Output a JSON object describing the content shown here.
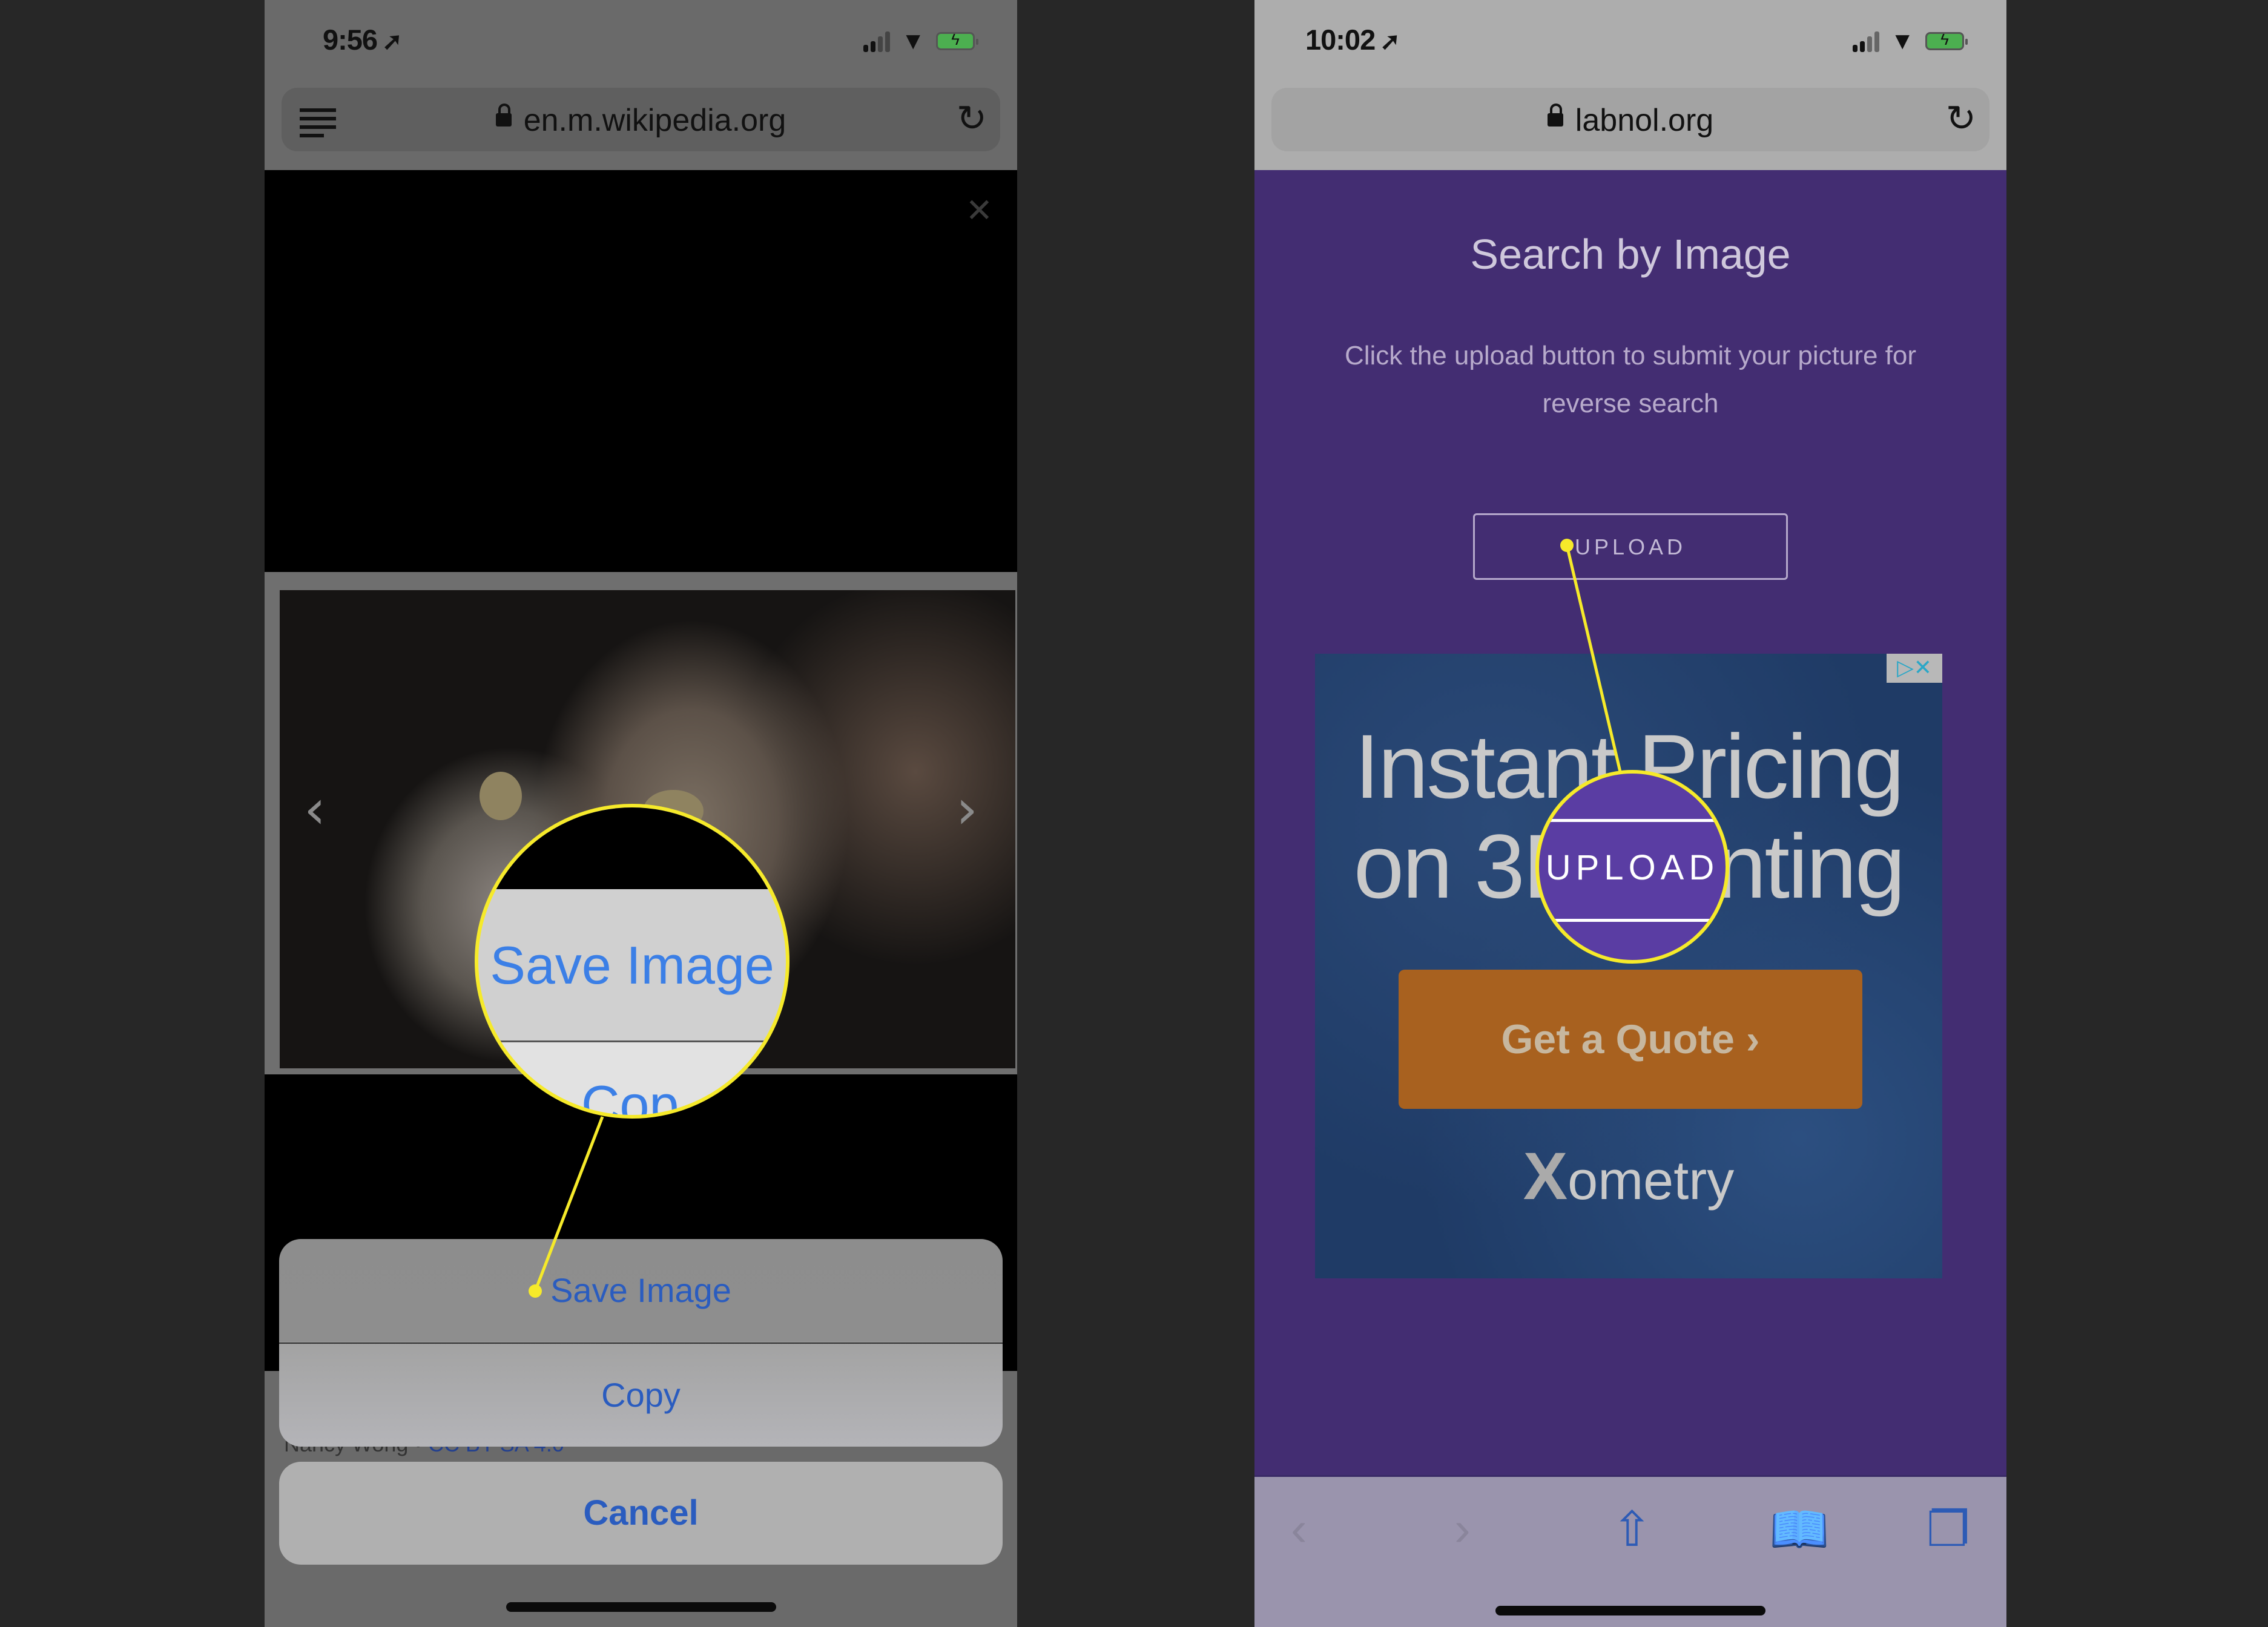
{
  "left_phone": {
    "status": {
      "time": "9:56",
      "location_glyph": "➚"
    },
    "url": "en.m.wikipedia.org",
    "reader_icon": "reader-icon",
    "close_glyph": "✕",
    "prev_glyph": "‹",
    "next_glyph": "›",
    "caption": {
      "author": "Nancy Wong",
      "separator": " • ",
      "license": "CC BY-SA 4.0"
    },
    "action_sheet": {
      "items": [
        "Save Image",
        "Copy"
      ],
      "cancel": "Cancel"
    },
    "magnifier": {
      "label": "Save Image",
      "peek": "Cop"
    }
  },
  "right_phone": {
    "status": {
      "time": "10:02",
      "location_glyph": "➚"
    },
    "url": "labnol.org",
    "title": "Search by Image",
    "description": "Click the upload button to submit your picture for reverse search",
    "upload_label": "UPLOAD",
    "ad": {
      "headline_line1": "Instant Pricing",
      "headline_line2": "on 3D Printing",
      "cta": "Get a Quote ›",
      "brand_x": "X",
      "brand_rest": "ometry",
      "adchoices": "▷✕"
    },
    "magnifier": {
      "label": "UPLOAD"
    },
    "toolbar": {
      "back": "‹",
      "forward": "›",
      "share": "⇧",
      "bookmarks": "📖",
      "tabs": "❐"
    }
  },
  "colors": {
    "callout": "#f6ea2a",
    "ios_blue": "#2a5cbf",
    "labnol_purple": "#432d72"
  }
}
